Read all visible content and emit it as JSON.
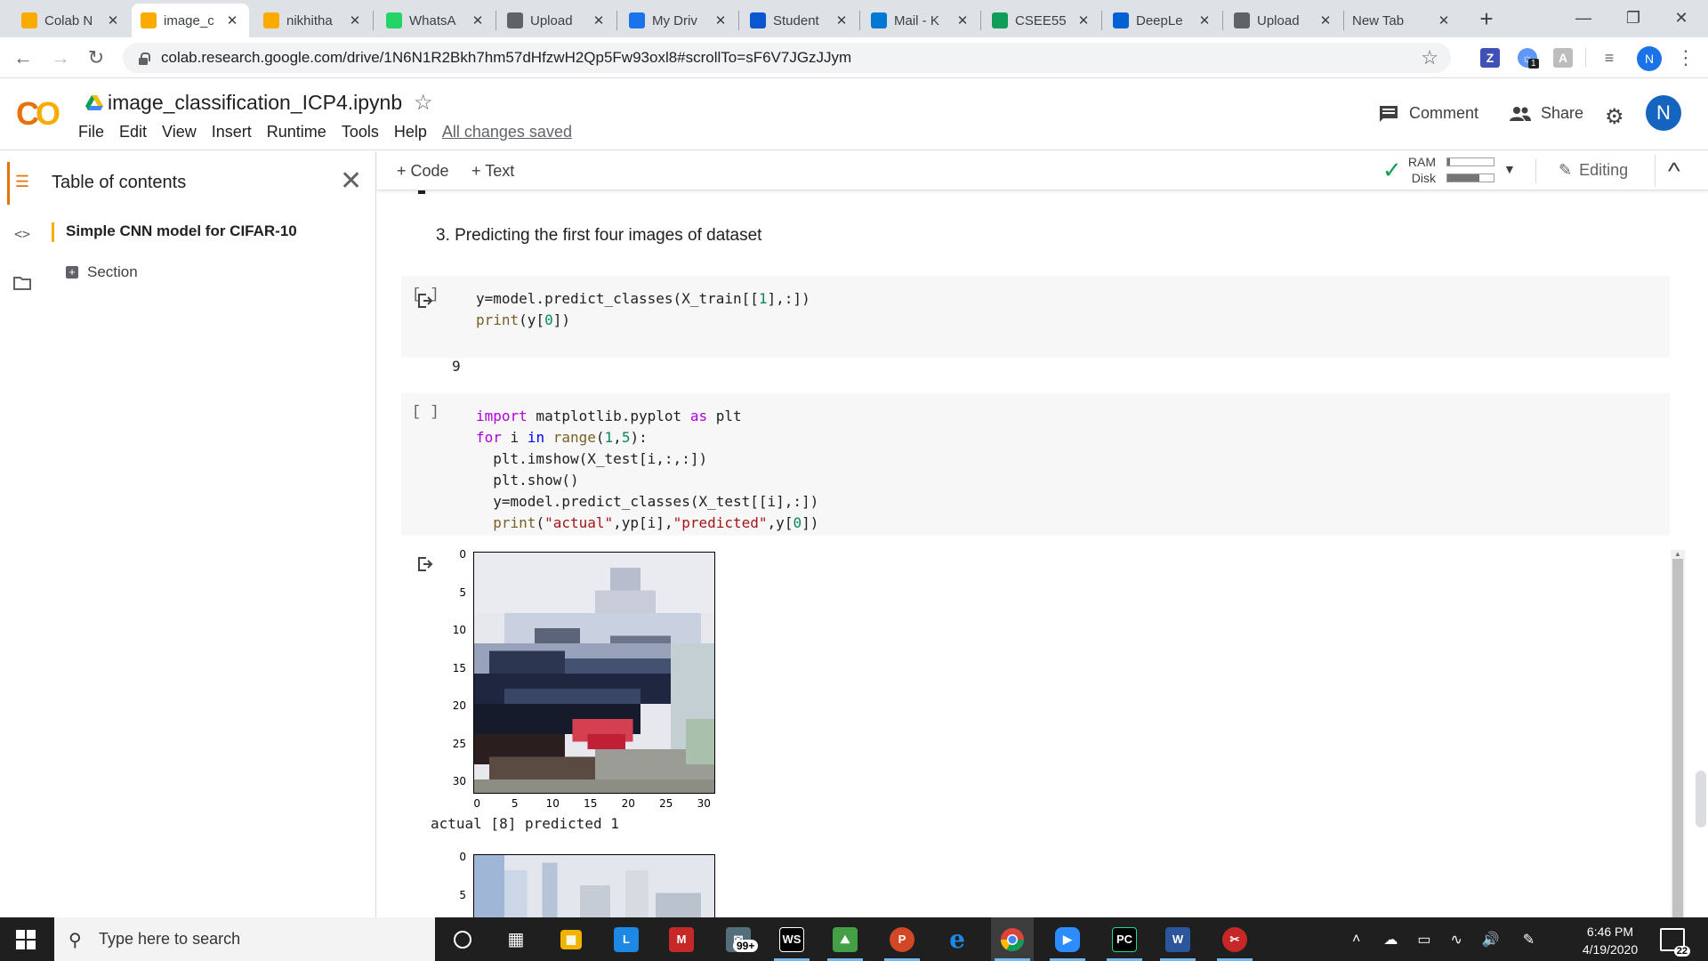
{
  "browser": {
    "tabs": [
      {
        "title": "Colab N",
        "favicon": "drive-icon",
        "color": "#f9ab00"
      },
      {
        "title": "image_c",
        "favicon": "colab-icon",
        "color": "#f9ab00",
        "active": true
      },
      {
        "title": "nikhitha",
        "favicon": "colab-icon",
        "color": "#f9ab00"
      },
      {
        "title": "WhatsA",
        "favicon": "whatsapp-icon",
        "color": "#25d366"
      },
      {
        "title": "Upload",
        "favicon": "github-icon",
        "color": "#5f6368"
      },
      {
        "title": "My Driv",
        "favicon": "drive-icon",
        "color": "#1a73e8"
      },
      {
        "title": "Student",
        "favicon": "student-icon",
        "color": "#0b57d0"
      },
      {
        "title": "Mail - K",
        "favicon": "outlook-icon",
        "color": "#0078d4"
      },
      {
        "title": "CSEE55",
        "favicon": "sheets-icon",
        "color": "#0f9d58"
      },
      {
        "title": "DeepLe",
        "favicon": "box-icon",
        "color": "#0061d5"
      },
      {
        "title": "Upload",
        "favicon": "github-icon",
        "color": "#5f6368"
      },
      {
        "title": "New Tab",
        "favicon": "",
        "color": ""
      }
    ],
    "url": "colab.research.google.com/drive/1N6N1R2Bkh7hm57dHfzwH2Qp5Fw93oxl8#scrollTo=sF6V7JGzJJym",
    "profile_initial": "N",
    "ext_badge": "1"
  },
  "colab": {
    "logo": "CO",
    "notebook_title": "image_classification_ICP4.ipynb",
    "menu": [
      "File",
      "Edit",
      "View",
      "Insert",
      "Runtime",
      "Tools",
      "Help"
    ],
    "save_status": "All changes saved",
    "comment_label": "Comment",
    "share_label": "Share",
    "avatar_initial": "N"
  },
  "toc": {
    "title": "Table of contents",
    "items": [
      {
        "label": "Simple CNN model for CIFAR-10"
      },
      {
        "label": "Section"
      }
    ]
  },
  "toolbar": {
    "add_code": "+ Code",
    "add_text": "+ Text",
    "ram_label": "RAM",
    "disk_label": "Disk",
    "ram_fraction": 0.05,
    "disk_fraction": 0.7,
    "editing_label": "Editing"
  },
  "cells": {
    "text_cell": "3. Predicting the first four images of dataset",
    "cell1_run": "[ ]",
    "cell1_output": "9",
    "cell2_run": "[ ]",
    "plot_output": "actual [8] predicted 1",
    "yticks": [
      "0",
      "5",
      "10",
      "15",
      "20",
      "25",
      "30"
    ],
    "xticks": [
      "0",
      "5",
      "10",
      "15",
      "20",
      "25",
      "30"
    ],
    "yticks2": [
      "0",
      "5"
    ]
  },
  "taskbar": {
    "search_placeholder": "Type here to search",
    "mail_badge": "99+",
    "time": "6:46 PM",
    "date": "4/19/2020",
    "notifications": "22"
  }
}
